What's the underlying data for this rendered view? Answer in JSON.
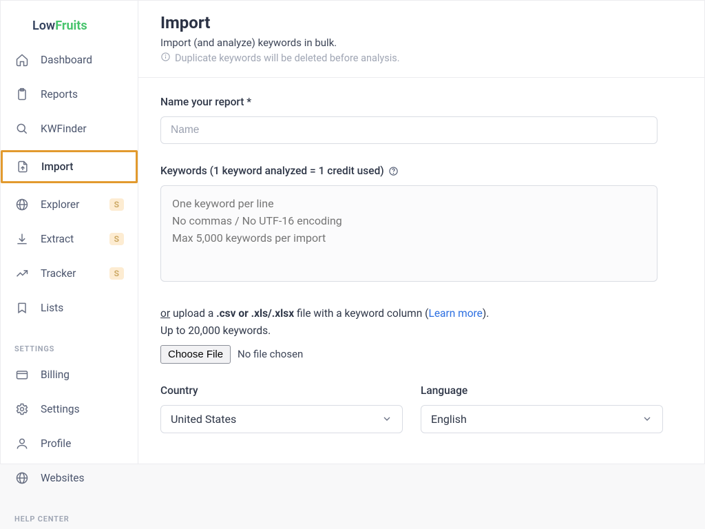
{
  "brand": {
    "part1": "Low",
    "part2": "Fruits"
  },
  "sidebar": {
    "items": [
      {
        "label": "Dashboard"
      },
      {
        "label": "Reports"
      },
      {
        "label": "KWFinder"
      },
      {
        "label": "Import"
      },
      {
        "label": "Explorer",
        "badge": "S"
      },
      {
        "label": "Extract",
        "badge": "S"
      },
      {
        "label": "Tracker",
        "badge": "S"
      },
      {
        "label": "Lists"
      }
    ],
    "settings_label": "SETTINGS",
    "settings_items": [
      {
        "label": "Billing"
      },
      {
        "label": "Settings"
      },
      {
        "label": "Profile"
      },
      {
        "label": "Websites"
      }
    ],
    "help_label": "HELP CENTER"
  },
  "header": {
    "title": "Import",
    "subtitle": "Import (and analyze) keywords in bulk.",
    "note": "Duplicate keywords will be deleted before analysis."
  },
  "form": {
    "name_label": "Name your report *",
    "name_placeholder": "Name",
    "keywords_label": "Keywords (1 keyword analyzed = 1 credit used)",
    "keywords_placeholder": "One keyword per line\nNo commas / No UTF-16 encoding\nMax 5,000 keywords per import",
    "upload_or": "or",
    "upload_text1": " upload a ",
    "upload_strong": ".csv or .xls/.xlsx",
    "upload_text2": " file with a keyword column (",
    "upload_link": "Learn more",
    "upload_text3": ").",
    "upload_limit": "Up to 20,000 keywords.",
    "choose_file": "Choose File",
    "no_file": "No file chosen",
    "country_label": "Country",
    "country_value": "United States",
    "language_label": "Language",
    "language_value": "English"
  }
}
